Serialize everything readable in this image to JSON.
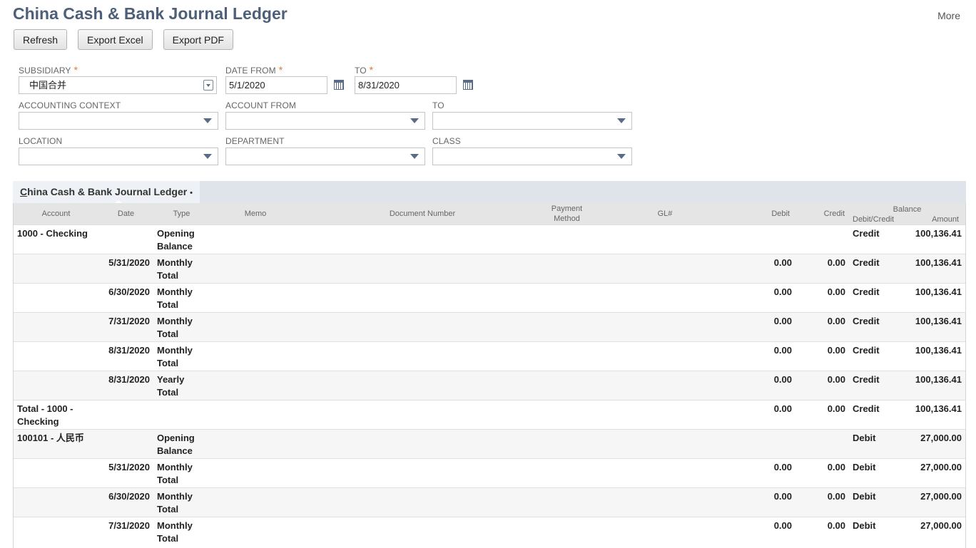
{
  "header": {
    "title": "China Cash & Bank Journal Ledger",
    "more": "More"
  },
  "toolbar": {
    "refresh": "Refresh",
    "export_excel": "Export Excel",
    "export_pdf": "Export PDF"
  },
  "filters": {
    "subsidiary": {
      "label": "SUBSIDIARY",
      "value": "中国合并"
    },
    "date_from": {
      "label": "DATE FROM",
      "value": "5/1/2020"
    },
    "date_to": {
      "label": "TO",
      "value": "8/31/2020"
    },
    "accounting_context": {
      "label": "ACCOUNTING CONTEXT",
      "value": ""
    },
    "account_from": {
      "label": "ACCOUNT FROM",
      "value": ""
    },
    "account_to": {
      "label": "TO",
      "value": ""
    },
    "location": {
      "label": "LOCATION",
      "value": ""
    },
    "department": {
      "label": "DEPARTMENT",
      "value": ""
    },
    "class": {
      "label": "CLASS",
      "value": ""
    },
    "required_mark": "*"
  },
  "tab": {
    "label_first": "C",
    "label_rest": "hina Cash & Bank Journal Ledger",
    "dot": "•"
  },
  "table": {
    "headers": {
      "account": "Account",
      "date": "Date",
      "type": "Type",
      "memo": "Memo",
      "document_number": "Document Number",
      "payment_method_1": "Payment",
      "payment_method_2": "Method",
      "gl": "GL#",
      "debit": "Debit",
      "credit": "Credit",
      "balance": "Balance",
      "balance_dc": "Debit/Credit",
      "balance_amount": "Amount"
    },
    "rows": [
      {
        "account": "1000 - Checking",
        "date": "",
        "type": "Opening Balance",
        "debit": "",
        "credit": "",
        "dc": "Credit",
        "amount": "100,136.41"
      },
      {
        "account": "",
        "date": "5/31/2020",
        "type": "Monthly Total",
        "debit": "0.00",
        "credit": "0.00",
        "dc": "Credit",
        "amount": "100,136.41"
      },
      {
        "account": "",
        "date": "6/30/2020",
        "type": "Monthly Total",
        "debit": "0.00",
        "credit": "0.00",
        "dc": "Credit",
        "amount": "100,136.41"
      },
      {
        "account": "",
        "date": "7/31/2020",
        "type": "Monthly Total",
        "debit": "0.00",
        "credit": "0.00",
        "dc": "Credit",
        "amount": "100,136.41"
      },
      {
        "account": "",
        "date": "8/31/2020",
        "type": "Monthly Total",
        "debit": "0.00",
        "credit": "0.00",
        "dc": "Credit",
        "amount": "100,136.41"
      },
      {
        "account": "",
        "date": "8/31/2020",
        "type": "Yearly Total",
        "debit": "0.00",
        "credit": "0.00",
        "dc": "Credit",
        "amount": "100,136.41"
      },
      {
        "account": "Total - 1000 - Checking",
        "date": "",
        "type": "",
        "debit": "0.00",
        "credit": "0.00",
        "dc": "Credit",
        "amount": "100,136.41"
      },
      {
        "account": "100101 - 人民币",
        "date": "",
        "type": "Opening Balance",
        "debit": "",
        "credit": "",
        "dc": "Debit",
        "amount": "27,000.00"
      },
      {
        "account": "",
        "date": "5/31/2020",
        "type": "Monthly Total",
        "debit": "0.00",
        "credit": "0.00",
        "dc": "Debit",
        "amount": "27,000.00"
      },
      {
        "account": "",
        "date": "6/30/2020",
        "type": "Monthly Total",
        "debit": "0.00",
        "credit": "0.00",
        "dc": "Debit",
        "amount": "27,000.00"
      },
      {
        "account": "",
        "date": "7/31/2020",
        "type": "Monthly Total",
        "debit": "0.00",
        "credit": "0.00",
        "dc": "Debit",
        "amount": "27,000.00"
      }
    ]
  },
  "icons": {
    "calendar": "calendar-icon",
    "select": "chevron-down-icon",
    "popup": "popup-picker-icon"
  }
}
